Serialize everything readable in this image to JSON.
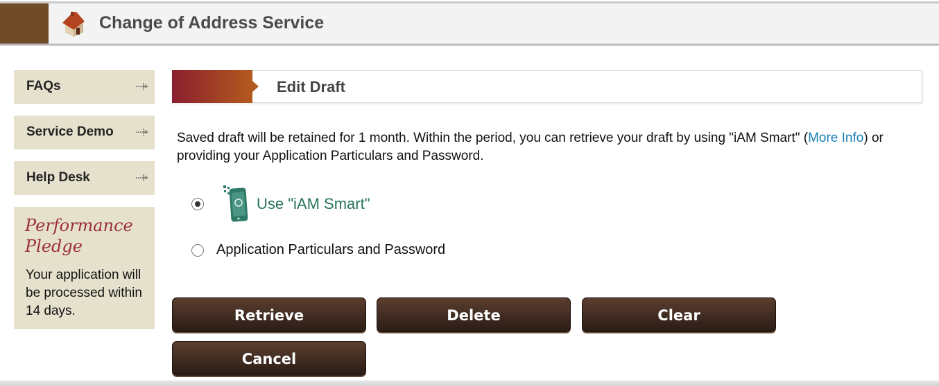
{
  "header": {
    "title": "Change of Address Service",
    "icon": "house-icon"
  },
  "sidebar": {
    "items": [
      {
        "label": "FAQs",
        "icon": "expand-arrow-icon"
      },
      {
        "label": "Service Demo",
        "icon": "expand-arrow-icon"
      },
      {
        "label": "Help Desk",
        "icon": "expand-arrow-icon"
      }
    ],
    "pledge": {
      "title_line1": "Performance",
      "title_line2": "Pledge",
      "text": "Your application will be processed within 14 days."
    }
  },
  "main": {
    "heading": "Edit Draft",
    "description_part1": "Saved draft will be retained for 1 month. Within the period, you can retrieve your draft by using \"iAM Smart\" (",
    "more_info_link": "More Info",
    "description_part2": ") or providing your Application Particulars and Password.",
    "options": [
      {
        "label": "Use \"iAM Smart\"",
        "selected": true,
        "icon": "iam-smart-phone-icon"
      },
      {
        "label": "Application Particulars and Password",
        "selected": false
      }
    ],
    "buttons": {
      "retrieve": "Retrieve",
      "delete": "Delete",
      "clear": "Clear",
      "cancel": "Cancel"
    }
  },
  "colors": {
    "brand_brown": "#704b29",
    "panel_beige": "#e6e1cd",
    "link_blue": "#1a7fb5",
    "iam_green": "#26735e"
  }
}
